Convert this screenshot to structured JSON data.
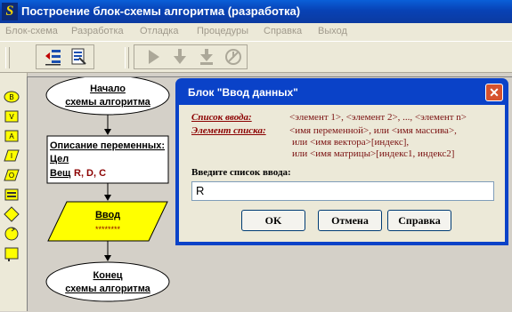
{
  "window": {
    "title": "Построение блок-схемы алгоритма (разработка)",
    "icon": "S"
  },
  "menu": {
    "items": [
      {
        "label": "Блок-схема"
      },
      {
        "label": "Разработка"
      },
      {
        "label": "Отладка"
      },
      {
        "label": "Процедуры"
      },
      {
        "label": "Справка"
      },
      {
        "label": "Выход"
      }
    ]
  },
  "flowchart": {
    "start": {
      "line1": "Начало",
      "line2": "схемы алгоритма"
    },
    "vars": {
      "title": "Описание переменных:",
      "int_label": "Цел",
      "real_label": "Вещ",
      "real_vars": "R, D, C"
    },
    "input_block": {
      "title": "Ввод",
      "content": "********"
    },
    "end": {
      "line1": "Конец",
      "line2": "схемы алгоритма"
    }
  },
  "dialog": {
    "title": "Блок \"Ввод данных\"",
    "list_label": "Список ввода:",
    "list_syntax": "<элемент 1>, <элемент 2>, ..., <элемент n>",
    "element_label": "Элемент списка:",
    "element_syntax_1": "<имя переменной>,  или   <имя массива>,",
    "element_syntax_2": "или   <имя вектора>[индекс],",
    "element_syntax_3": "или   <имя матрицы>[индекс1, индекс2]",
    "prompt": "Введите список ввода:",
    "input_value": "R",
    "ok_label": "OK",
    "cancel_label": "Отмена",
    "help_label": "Справка"
  },
  "colors": {
    "title_bar": "#0842b5",
    "io_block": "#ffff00",
    "label_red": "#8b0000",
    "workspace": "#d4d0c8"
  }
}
